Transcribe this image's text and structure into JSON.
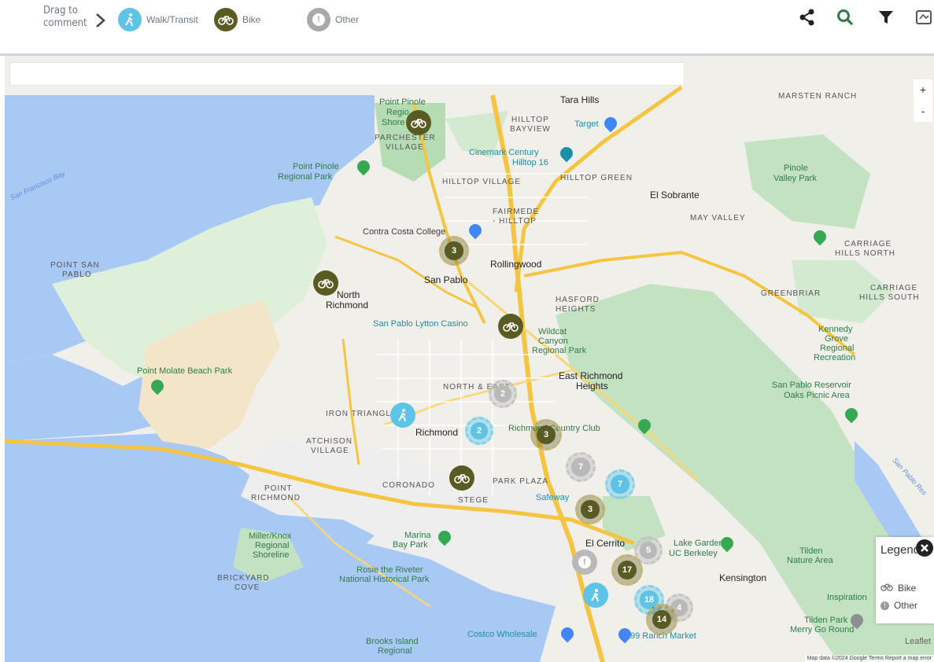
{
  "toolbar": {
    "drag_label_line1": "Drag to",
    "drag_label_line2": "comment",
    "legend_items": [
      {
        "label": "Walk/Transit",
        "icon": "walk-icon",
        "color": "#5ec3e6"
      },
      {
        "label": "Bike",
        "icon": "bike-icon",
        "color": "#595b22"
      },
      {
        "label": "Other",
        "icon": "exclamation-icon",
        "color": "#a9a9a9"
      }
    ],
    "tools": [
      "share-icon",
      "search-icon",
      "filter-icon",
      "layers-icon"
    ],
    "accent": "#2e7d46"
  },
  "map": {
    "zoom_in": "+",
    "zoom_out": "-",
    "labels": {
      "tara_hills": "Tara Hills",
      "marsten_ranch": "MARSTEN RANCH",
      "point_pinole": "Point Pinole",
      "regio": "Regio",
      "shore": "Shore",
      "parchester": "PARCHESTER",
      "village": "VILLAGE",
      "hilltop_bayview1": "HILLTOP",
      "hilltop_bayview2": "BAYVIEW",
      "target": "Target",
      "cinemark1": "Cinemark Century",
      "cinemark2": "Hilltop 16",
      "point_pinole_rp1": "Point Pinole",
      "point_pinole_rp2": "Regional Park",
      "hilltop_village": "HILLTOP VILLAGE",
      "hilltop_green": "HILLTOP GREEN",
      "el_sobrante": "El Sobrante",
      "pinole1": "Pinole",
      "pinole2": "Valley Park",
      "fairmede1": "FAIRMEDE",
      "fairmede2": "- HILLTOP",
      "may_valley": "MAY VALLEY",
      "contra_costa": "Contra Costa College",
      "carriage_north1": "CARRIAGE",
      "carriage_north2": "HILLS NORTH",
      "point_san1": "POINT SAN",
      "point_san2": "PABLO",
      "rollingwood": "Rollingwood",
      "san_pablo": "San Pablo",
      "north": "North",
      "richmond_n": "Richmond",
      "greenbriar": "GREENBRIAR",
      "carriage_south1": "CARRIAGE",
      "carriage_south2": "HILLS SOUTH",
      "hasford1": "HASFORD",
      "hasford2": "HEIGHTS",
      "lytton": "San Pablo Lytton Casino",
      "wildcat1": "Wildcat",
      "wildcat2": "Canyon",
      "wildcat3": "Regional Park",
      "kennedy1": "Kennedy",
      "kennedy2": "Grove",
      "kennedy3": "Regional",
      "kennedy4": "Recreation",
      "molate": "Point Molate Beach Park",
      "east_richmond1": "East Richmond",
      "east_richmond2": "Heights",
      "reservoir1": "San Pablo Reservoir",
      "reservoir2": "Oaks Picnic Area",
      "north_east": "NORTH & EAST",
      "iron_triangle": "IRON TRIANGLE",
      "richmond": "Richmond",
      "country_club": "Richmond Country Club",
      "atchison1": "ATCHISON",
      "atchison2": "VILLAGE",
      "point_richmond1": "POINT",
      "point_richmond2": "RICHMOND",
      "coronado": "CORONADO",
      "park_plaza": "PARK PLAZA",
      "stege": "STEGE",
      "safeway": "Safeway",
      "miller1": "Miller/Knox",
      "miller2": "Regional",
      "miller3": "Shoreline",
      "marina1": "Marina",
      "marina2": "Bay Park",
      "el_cerrito": "El Cerrito",
      "lake_garden1": "Lake Garden",
      "lake_garden2": "UC Berkeley",
      "tilden1": "Tilden",
      "tilden2": "Nature Area",
      "brickyard1": "BRICKYARD",
      "brickyard2": "COVE",
      "rosie1": "Rosie the Riveter",
      "rosie2": "National Historical Park",
      "kensington": "Kensington",
      "inspiration": "Inspiration",
      "tilden_park1": "Tilden Park",
      "tilden_park2": "Merry Go Round",
      "costco": "Costco Wholesale",
      "ranch": "99 Ranch Market",
      "brooks1": "Brooks Island",
      "brooks2": "Regional",
      "sf_bay": "San Francisco Bay",
      "sp_reservoir": "San Pablo Res"
    },
    "clusters": [
      {
        "type": "bike",
        "count": "3"
      },
      {
        "type": "other",
        "count": "2"
      },
      {
        "type": "walk",
        "count": "2"
      },
      {
        "type": "bike",
        "count": "3"
      },
      {
        "type": "other",
        "count": "7"
      },
      {
        "type": "walk",
        "count": "7"
      },
      {
        "type": "bike",
        "count": "3"
      },
      {
        "type": "other",
        "count": "5"
      },
      {
        "type": "bike",
        "count": "17"
      },
      {
        "type": "walk",
        "count": "18"
      },
      {
        "type": "other",
        "count": "4"
      },
      {
        "type": "bike",
        "count": "14"
      }
    ],
    "attribution": "Map data ©2024 Google   Terms   Report a map error",
    "leaflet": "Leaflet"
  },
  "legend_panel": {
    "title": "Legend",
    "items": [
      {
        "label": "Bike",
        "icon": "bike-icon"
      },
      {
        "label": "Other",
        "icon": "exclamation-icon"
      }
    ]
  },
  "colors": {
    "bike": "#595b22",
    "walk": "#5ec3e6",
    "other": "#b9b9b9",
    "water": "#a9c9f5",
    "park": "#c3e2c1",
    "land": "#f1efea"
  }
}
